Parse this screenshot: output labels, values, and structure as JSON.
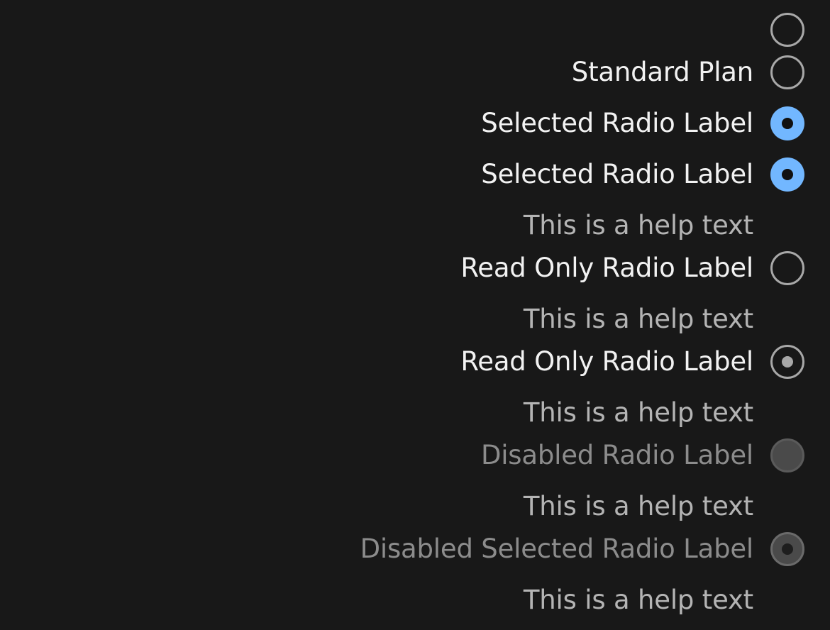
{
  "radios": [
    {
      "label": "",
      "state": "unchecked"
    },
    {
      "label": "Standard Plan",
      "state": "unchecked"
    },
    {
      "label": "Selected Radio Label",
      "state": "selected"
    },
    {
      "label": "Selected Radio Label",
      "state": "selected",
      "help": "This is a help text"
    },
    {
      "label": "Read Only Radio Label",
      "state": "readonly",
      "help": "This is a help text"
    },
    {
      "label": "Read Only Radio Label",
      "state": "readonly-selected",
      "help": "This is a help text"
    },
    {
      "label": "Disabled Radio Label",
      "state": "disabled",
      "help": "This is a help text"
    },
    {
      "label": "Disabled Selected Radio Label",
      "state": "disabled-selected",
      "help": "This is a help text"
    }
  ],
  "colors": {
    "background": "#181818",
    "accent": "#72b7ff",
    "label": "#f2f2f2",
    "help": "#b4b4b4",
    "disabled": "#8c8c8c"
  }
}
